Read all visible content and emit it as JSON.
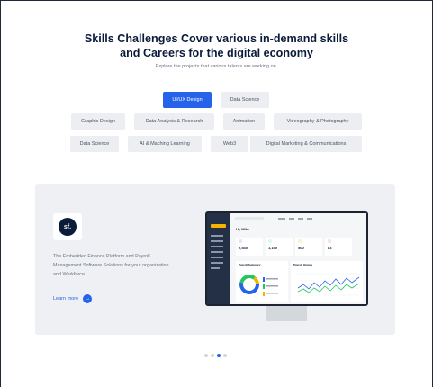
{
  "hero": {
    "title_line1": "Skills Challenges Cover various in-demand skills",
    "title_line2": "and Careers for the digital economy",
    "subtitle": "Explore the projects that various talents are working on."
  },
  "filters": {
    "row1": [
      "UI/UX Design",
      "Data Science"
    ],
    "row2": [
      "Graphic Design",
      "Data Analysis & Research",
      "Animation",
      "Videography & Photography"
    ],
    "row3": [
      "Data Science",
      "AI & Maching Learning",
      "Web3",
      "Digital Marketing & Communications"
    ],
    "active": "UI/UX Design"
  },
  "showcase": {
    "logo_text": "sf.",
    "description": "The Embedded Finance Platform and Payroll Management Software Solutions for your organization and Workforce.",
    "learn_more": "Learn more",
    "arrow_icon": "arrow-right-icon",
    "dashboard": {
      "greeting": "Hi, Mike",
      "stats": [
        "2,540",
        "1,150",
        "500",
        "83"
      ],
      "payroll_summary": "Payroll Summary",
      "payroll_history": "Payroll History"
    }
  },
  "carousel": {
    "count": 4,
    "active_index": 2
  },
  "colors": {
    "accent": "#2563eb",
    "navy": "#0b1b3a",
    "panel": "#eef0f3"
  }
}
